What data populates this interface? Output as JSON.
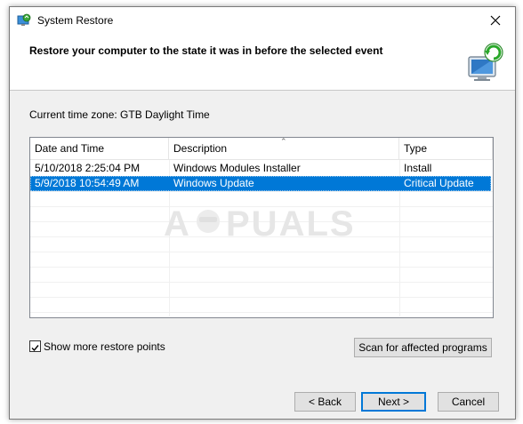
{
  "window": {
    "title": "System Restore",
    "icons": {
      "app": "system-restore-icon",
      "close": "close-icon",
      "header": "monitor-restore-icon"
    }
  },
  "header": {
    "text": "Restore your computer to the state it was in before the selected event"
  },
  "timezone": {
    "label": "Current time zone: GTB Daylight Time"
  },
  "table": {
    "columns": [
      "Date and Time",
      "Description",
      "Type"
    ],
    "sorted_column": "Description",
    "rows": [
      {
        "date": "5/10/2018 2:25:04 PM",
        "description": "Windows Modules Installer",
        "type": "Install",
        "selected": false
      },
      {
        "date": "5/9/2018 10:54:49 AM",
        "description": "Windows Update",
        "type": "Critical Update",
        "selected": true
      }
    ]
  },
  "watermark": {
    "text": "A PUALS"
  },
  "options": {
    "show_more_label": "Show more restore points",
    "show_more_checked": true
  },
  "buttons": {
    "scan": "Scan for affected programs",
    "back": "< Back",
    "next": "Next >",
    "cancel": "Cancel"
  },
  "colors": {
    "selection": "#0078d7",
    "default_button_border": "#0078d7",
    "content_bg": "#f0f0f0"
  }
}
